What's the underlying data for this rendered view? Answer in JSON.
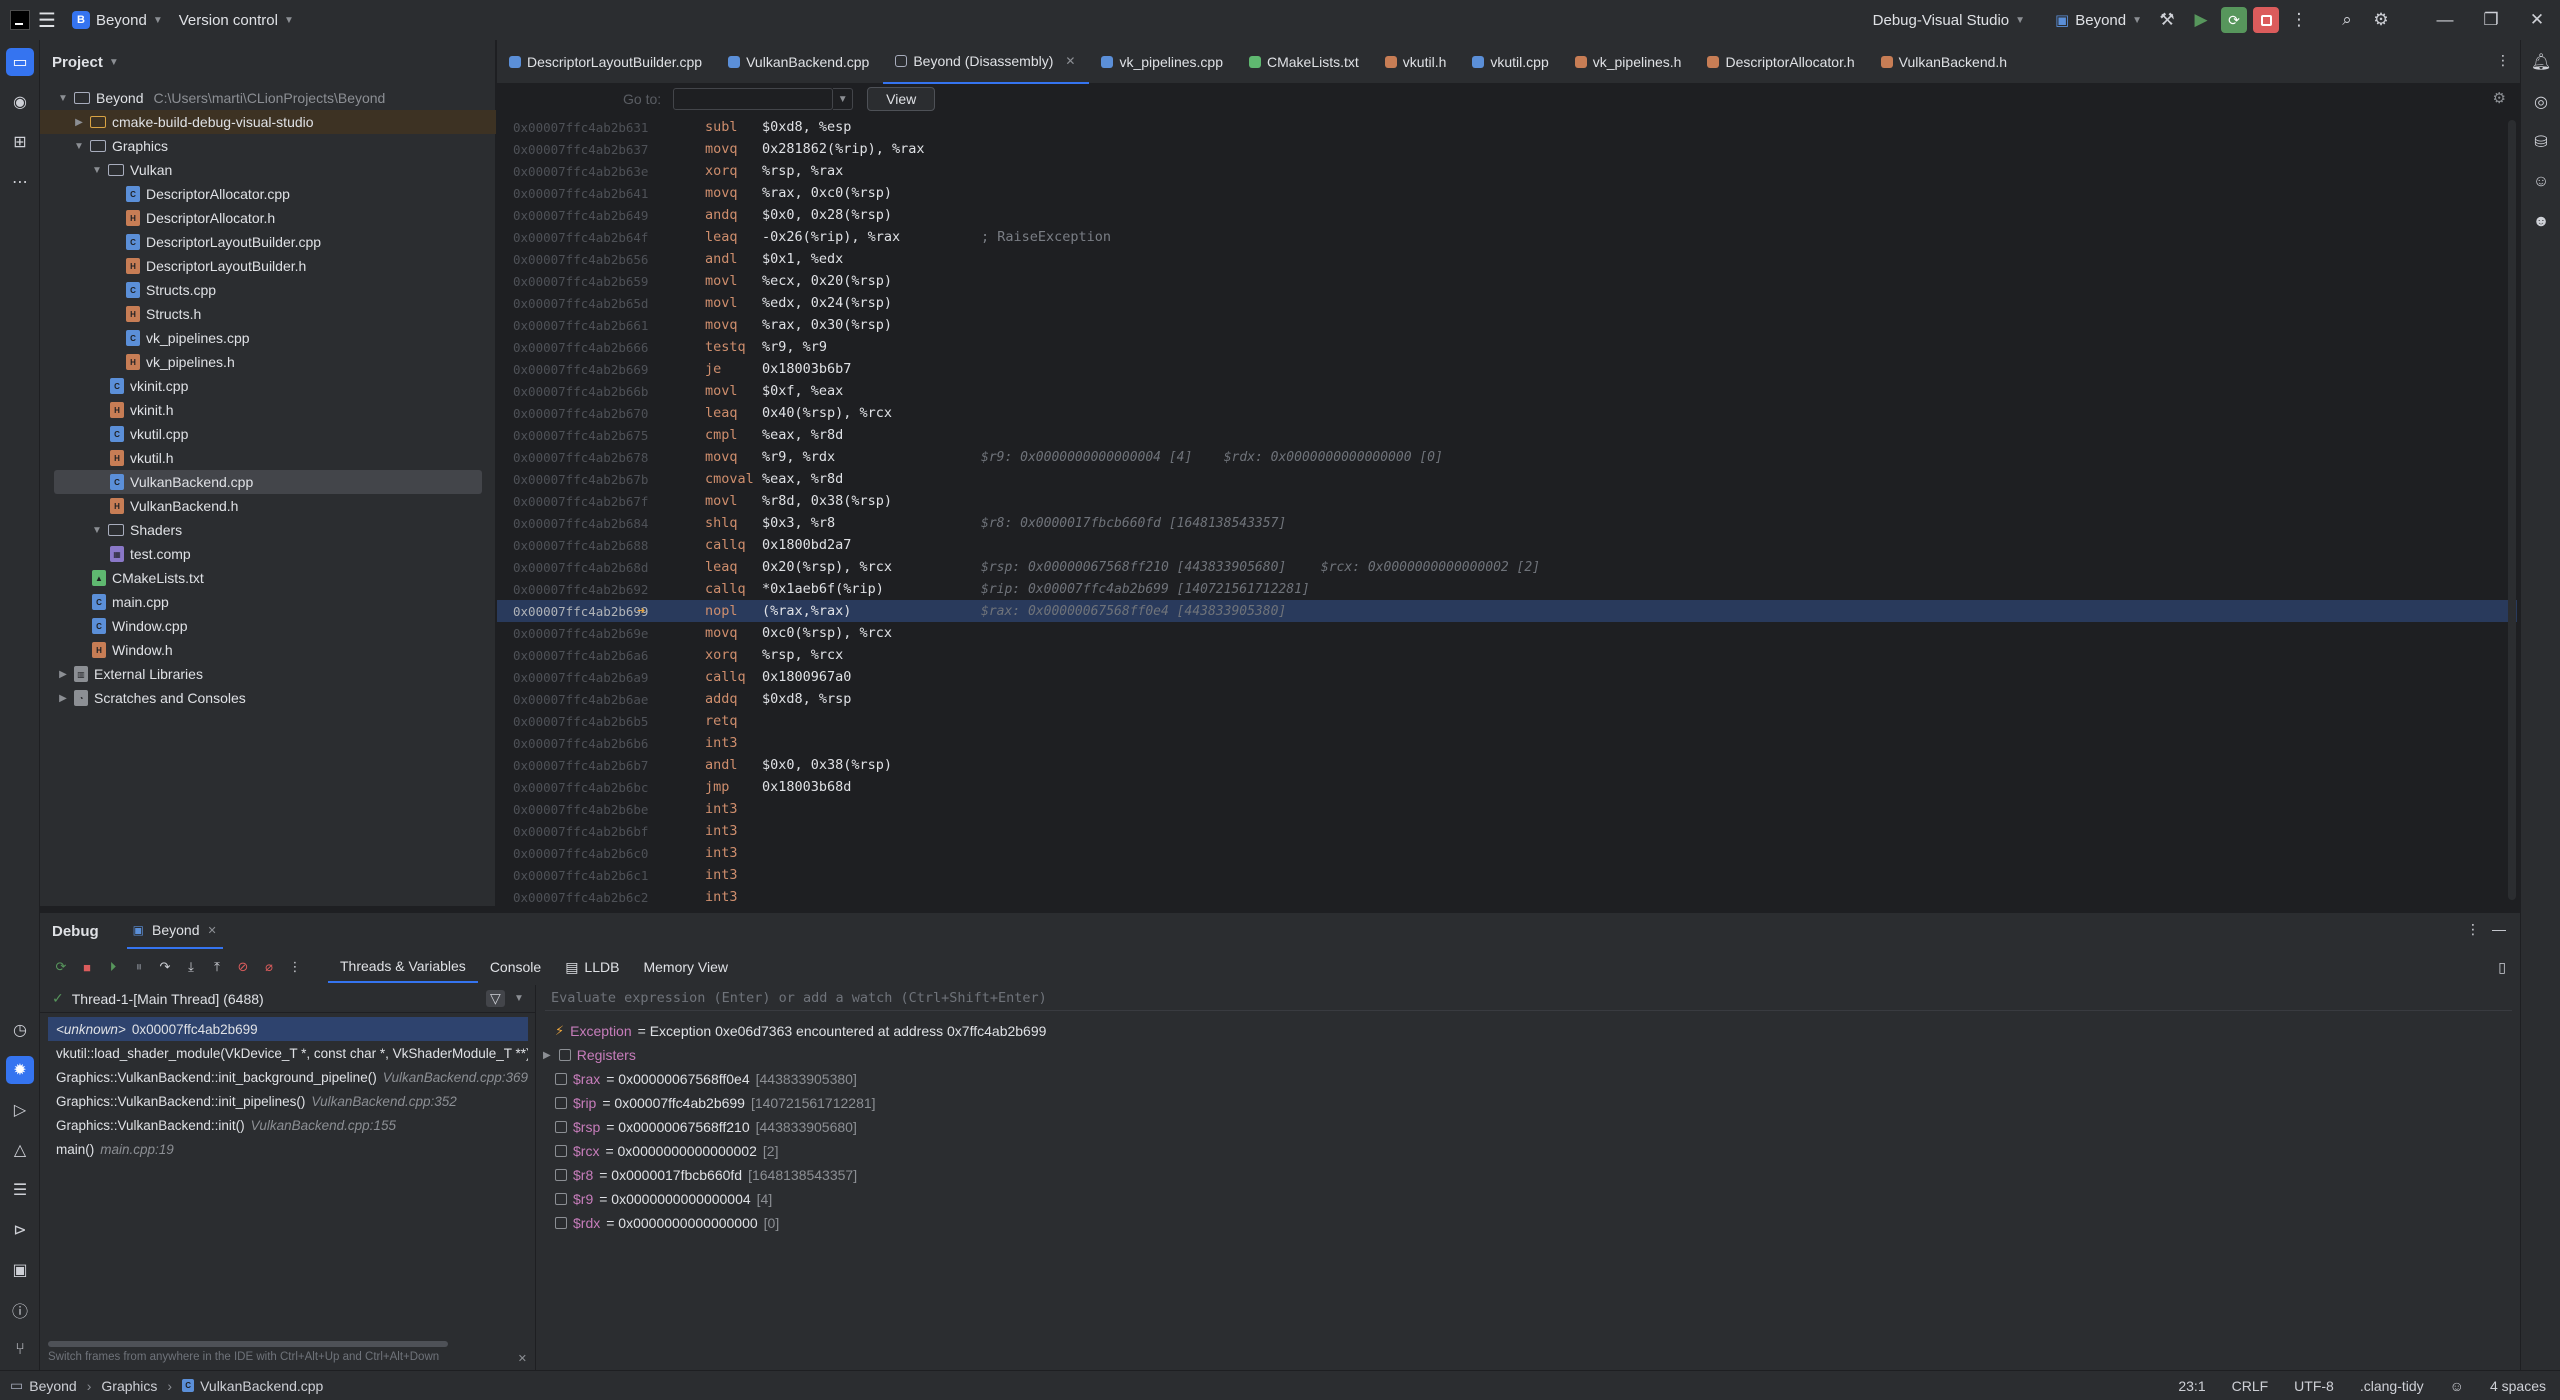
{
  "titlebar": {
    "project_badge": "B",
    "project_name": "Beyond",
    "vcs": "Version control",
    "config": "Debug-Visual Studio",
    "run_target": "Beyond"
  },
  "project_panel": {
    "title": "Project",
    "root_name": "Beyond",
    "root_path": "C:\\Users\\marti\\CLionProjects\\Beyond",
    "items": [
      {
        "label": "cmake-build-debug-visual-studio"
      },
      {
        "label": "Graphics"
      },
      {
        "label": "Vulkan"
      },
      {
        "label": "DescriptorAllocator.cpp"
      },
      {
        "label": "DescriptorAllocator.h"
      },
      {
        "label": "DescriptorLayoutBuilder.cpp"
      },
      {
        "label": "DescriptorLayoutBuilder.h"
      },
      {
        "label": "Structs.cpp"
      },
      {
        "label": "Structs.h"
      },
      {
        "label": "vk_pipelines.cpp"
      },
      {
        "label": "vk_pipelines.h"
      },
      {
        "label": "vkinit.cpp"
      },
      {
        "label": "vkinit.h"
      },
      {
        "label": "vkutil.cpp"
      },
      {
        "label": "vkutil.h"
      },
      {
        "label": "VulkanBackend.cpp"
      },
      {
        "label": "VulkanBackend.h"
      },
      {
        "label": "Shaders"
      },
      {
        "label": "test.comp"
      },
      {
        "label": "CMakeLists.txt"
      },
      {
        "label": "main.cpp"
      },
      {
        "label": "Window.cpp"
      },
      {
        "label": "Window.h"
      },
      {
        "label": "External Libraries"
      },
      {
        "label": "Scratches and Consoles"
      }
    ]
  },
  "tabs": [
    {
      "label": "DescriptorLayoutBuilder.cpp"
    },
    {
      "label": "VulkanBackend.cpp"
    },
    {
      "label": "Beyond (Disassembly)"
    },
    {
      "label": "vk_pipelines.cpp"
    },
    {
      "label": "CMakeLists.txt"
    },
    {
      "label": "vkutil.h"
    },
    {
      "label": "vkutil.cpp"
    },
    {
      "label": "vk_pipelines.h"
    },
    {
      "label": "DescriptorAllocator.h"
    },
    {
      "label": "VulkanBackend.h"
    }
  ],
  "gotobar": {
    "label": "Go to:",
    "view_label": "View"
  },
  "disassembly": [
    {
      "addr": "0x00007ffc4ab2b631",
      "mn": "subl",
      "op": "$0xd8, %esp"
    },
    {
      "addr": "0x00007ffc4ab2b637",
      "mn": "movq",
      "op": "0x281862(%rip), %rax"
    },
    {
      "addr": "0x00007ffc4ab2b63e",
      "mn": "xorq",
      "op": "%rsp, %rax"
    },
    {
      "addr": "0x00007ffc4ab2b641",
      "mn": "movq",
      "op": "%rax, 0xc0(%rsp)"
    },
    {
      "addr": "0x00007ffc4ab2b649",
      "mn": "andq",
      "op": "$0x0, 0x28(%rsp)"
    },
    {
      "addr": "0x00007ffc4ab2b64f",
      "mn": "leaq",
      "op": "-0x26(%rip), %rax",
      "comment": "; RaiseException"
    },
    {
      "addr": "0x00007ffc4ab2b656",
      "mn": "andl",
      "op": "$0x1, %edx"
    },
    {
      "addr": "0x00007ffc4ab2b659",
      "mn": "movl",
      "op": "%ecx, 0x20(%rsp)"
    },
    {
      "addr": "0x00007ffc4ab2b65d",
      "mn": "movl",
      "op": "%edx, 0x24(%rsp)"
    },
    {
      "addr": "0x00007ffc4ab2b661",
      "mn": "movq",
      "op": "%rax, 0x30(%rsp)"
    },
    {
      "addr": "0x00007ffc4ab2b666",
      "mn": "testq",
      "op": "%r9, %r9"
    },
    {
      "addr": "0x00007ffc4ab2b669",
      "mn": "je",
      "op": "0x18003b6b7"
    },
    {
      "addr": "0x00007ffc4ab2b66b",
      "mn": "movl",
      "op": "$0xf, %eax"
    },
    {
      "addr": "0x00007ffc4ab2b670",
      "mn": "leaq",
      "op": "0x40(%rsp), %rcx"
    },
    {
      "addr": "0x00007ffc4ab2b675",
      "mn": "cmpl",
      "op": "%eax, %r8d"
    },
    {
      "addr": "0x00007ffc4ab2b678",
      "mn": "movq",
      "op": "%r9, %rdx",
      "hint": "$r9: 0x0000000000000004 [4]",
      "hint2": "$rdx: 0x0000000000000000 [0]"
    },
    {
      "addr": "0x00007ffc4ab2b67b",
      "mn": "cmoval",
      "op": "%eax, %r8d"
    },
    {
      "addr": "0x00007ffc4ab2b67f",
      "mn": "movl",
      "op": "%r8d, 0x38(%rsp)"
    },
    {
      "addr": "0x00007ffc4ab2b684",
      "mn": "shlq",
      "op": "$0x3, %r8",
      "hint": "$r8: 0x0000017fbcb660fd [1648138543357]"
    },
    {
      "addr": "0x00007ffc4ab2b688",
      "mn": "callq",
      "op": "0x1800bd2a7"
    },
    {
      "addr": "0x00007ffc4ab2b68d",
      "mn": "leaq",
      "op": "0x20(%rsp), %rcx",
      "hint": "$rsp: 0x00000067568ff210 [443833905680]",
      "hint2": "$rcx: 0x0000000000000002 [2]"
    },
    {
      "addr": "0x00007ffc4ab2b692",
      "mn": "callq",
      "op": "*0x1aeb6f(%rip)",
      "hint": "$rip: 0x00007ffc4ab2b699 [140721561712281]"
    },
    {
      "addr": "0x00007ffc4ab2b699",
      "mn": "nopl",
      "op": "(%rax,%rax)",
      "hint": "$rax: 0x00000067568ff0e4 [443833905380]",
      "current": true
    },
    {
      "addr": "0x00007ffc4ab2b69e",
      "mn": "movq",
      "op": "0xc0(%rsp), %rcx"
    },
    {
      "addr": "0x00007ffc4ab2b6a6",
      "mn": "xorq",
      "op": "%rsp, %rcx"
    },
    {
      "addr": "0x00007ffc4ab2b6a9",
      "mn": "callq",
      "op": "0x1800967a0"
    },
    {
      "addr": "0x00007ffc4ab2b6ae",
      "mn": "addq",
      "op": "$0xd8, %rsp"
    },
    {
      "addr": "0x00007ffc4ab2b6b5",
      "mn": "retq",
      "op": ""
    },
    {
      "addr": "0x00007ffc4ab2b6b6",
      "mn": "int3",
      "op": ""
    },
    {
      "addr": "0x00007ffc4ab2b6b7",
      "mn": "andl",
      "op": "$0x0, 0x38(%rsp)"
    },
    {
      "addr": "0x00007ffc4ab2b6bc",
      "mn": "jmp",
      "op": "0x18003b68d"
    },
    {
      "addr": "0x00007ffc4ab2b6be",
      "mn": "int3",
      "op": ""
    },
    {
      "addr": "0x00007ffc4ab2b6bf",
      "mn": "int3",
      "op": ""
    },
    {
      "addr": "0x00007ffc4ab2b6c0",
      "mn": "int3",
      "op": ""
    },
    {
      "addr": "0x00007ffc4ab2b6c1",
      "mn": "int3",
      "op": ""
    },
    {
      "addr": "0x00007ffc4ab2b6c2",
      "mn": "int3",
      "op": ""
    }
  ],
  "debug": {
    "title": "Debug",
    "session": "Beyond",
    "subtabs": [
      "Threads & Variables",
      "Console",
      "LLDB",
      "Memory View"
    ],
    "thread": "Thread-1-[Main Thread] (6488)",
    "frames": [
      {
        "fn": "<unknown>",
        "loc": "0x00007ffc4ab2b699"
      },
      {
        "fn": "vkutil::load_shader_module(VkDevice_T *, const char *, VkShaderModule_T **)",
        "loc": ""
      },
      {
        "fn": "Graphics::VulkanBackend::init_background_pipeline()",
        "loc": "VulkanBackend.cpp:369"
      },
      {
        "fn": "Graphics::VulkanBackend::init_pipelines()",
        "loc": "VulkanBackend.cpp:352"
      },
      {
        "fn": "Graphics::VulkanBackend::init()",
        "loc": "VulkanBackend.cpp:155"
      },
      {
        "fn": "main()",
        "loc": "main.cpp:19"
      }
    ],
    "frames_hint": "Switch frames from anywhere in the IDE with Ctrl+Alt+Up and Ctrl+Alt+Down",
    "eval_placeholder": "Evaluate expression (Enter) or add a watch (Ctrl+Shift+Enter)",
    "exception_name": "Exception",
    "exception_value": "= Exception 0xe06d7363 encountered at address 0x7ffc4ab2b699",
    "registers_label": "Registers",
    "registers": [
      {
        "name": "$rax",
        "val": "= 0x00000067568ff0e4",
        "dec": "[443833905380]"
      },
      {
        "name": "$rip",
        "val": "= 0x00007ffc4ab2b699",
        "dec": "[140721561712281]"
      },
      {
        "name": "$rsp",
        "val": "= 0x00000067568ff210",
        "dec": "[443833905680]"
      },
      {
        "name": "$rcx",
        "val": "= 0x0000000000000002",
        "dec": "[2]"
      },
      {
        "name": "$r8",
        "val": "= 0x0000017fbcb660fd",
        "dec": "[1648138543357]"
      },
      {
        "name": "$r9",
        "val": "= 0x0000000000000004",
        "dec": "[4]"
      },
      {
        "name": "$rdx",
        "val": "= 0x0000000000000000",
        "dec": "[0]"
      }
    ]
  },
  "statusbar": {
    "crumbs": [
      "Beyond",
      "Graphics",
      "VulkanBackend.cpp"
    ],
    "position": "23:1",
    "line_sep": "CRLF",
    "encoding": "UTF-8",
    "linter": ".clang-tidy",
    "indent": "4 spaces"
  }
}
